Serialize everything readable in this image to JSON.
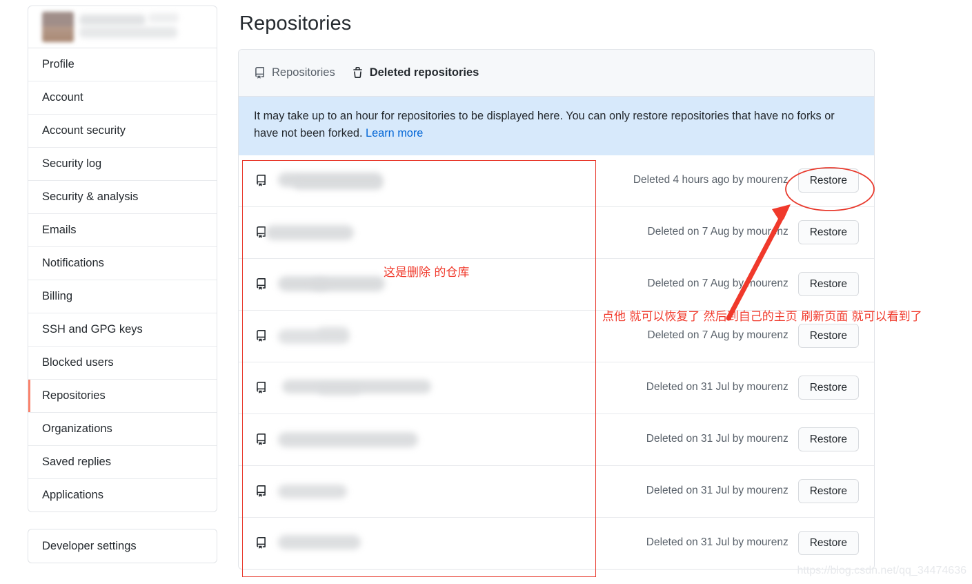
{
  "sidebar": {
    "profile": {
      "avatar_label": "user-avatar-blurred",
      "name_label": "username-blurred"
    },
    "items": [
      {
        "label": "Profile",
        "active": false
      },
      {
        "label": "Account",
        "active": false
      },
      {
        "label": "Account security",
        "active": false
      },
      {
        "label": "Security log",
        "active": false
      },
      {
        "label": "Security & analysis",
        "active": false
      },
      {
        "label": "Emails",
        "active": false
      },
      {
        "label": "Notifications",
        "active": false
      },
      {
        "label": "Billing",
        "active": false
      },
      {
        "label": "SSH and GPG keys",
        "active": false
      },
      {
        "label": "Blocked users",
        "active": false
      },
      {
        "label": "Repositories",
        "active": true
      },
      {
        "label": "Organizations",
        "active": false
      },
      {
        "label": "Saved replies",
        "active": false
      },
      {
        "label": "Applications",
        "active": false
      }
    ],
    "developer_settings": {
      "label": "Developer settings"
    }
  },
  "main": {
    "page_title": "Repositories",
    "tabs": [
      {
        "label": "Repositories",
        "icon": "repo-icon",
        "active": false
      },
      {
        "label": "Deleted repositories",
        "icon": "trash-icon",
        "active": true
      }
    ],
    "notice": {
      "text": "It may take up to an hour for repositories to be displayed here. You can only restore repositories that have no forks or have not been forked.",
      "link_label": "Learn more"
    },
    "restore_label": "Restore",
    "rows": [
      {
        "name_blurred": true,
        "name_width": 160,
        "deleted": "Deleted 4 hours ago by mourenz"
      },
      {
        "name_blurred": true,
        "name_width": 128,
        "deleted": "Deleted on 7 Aug by mourenz"
      },
      {
        "name_blurred": true,
        "name_width": 158,
        "deleted": "Deleted on 7 Aug by mourenz"
      },
      {
        "name_blurred": true,
        "name_width": 106,
        "deleted": "Deleted on 7 Aug by mourenz"
      },
      {
        "name_blurred": true,
        "name_width": 208,
        "deleted": "Deleted on 31 Jul by mourenz"
      },
      {
        "name_blurred": true,
        "name_width": 200,
        "deleted": "Deleted on 31 Jul by mourenz"
      },
      {
        "name_blurred": true,
        "name_width": 100,
        "deleted": "Deleted on 31 Jul by mourenz"
      },
      {
        "name_blurred": true,
        "name_width": 120,
        "deleted": "Deleted on 31 Jul by mourenz"
      }
    ]
  },
  "annotations": {
    "note_list": "这是删除 的仓库",
    "note_restore": "点他 就可以恢复了 然后到自己的主页 刷新页面 就可以看到了",
    "color": "#f0392b"
  },
  "watermark": "https://blog.csdn.net/qq_34474636",
  "colors": {
    "accent_active": "#f9826c",
    "link": "#0366d6",
    "notice_bg": "#d7e9fb",
    "annotation_red": "#f0392b",
    "border": "#e1e4e8"
  }
}
